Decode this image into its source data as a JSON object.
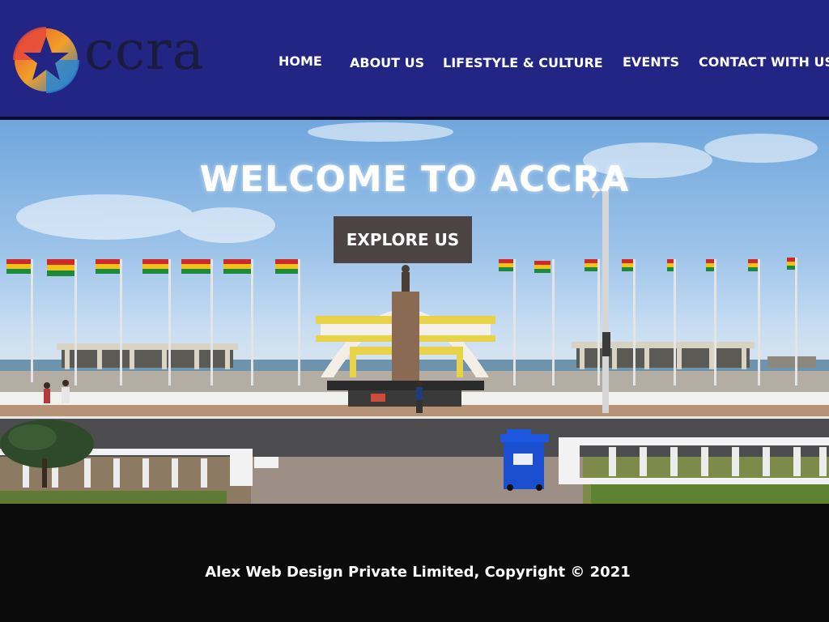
{
  "brand": {
    "logo_word": "ccra",
    "logo_tag": "",
    "logo_icon": "star-globe-icon"
  },
  "nav": {
    "items": [
      {
        "label": "HOME"
      },
      {
        "label": "ABOUT US"
      },
      {
        "label": "LIFESTYLE & CULTURE"
      },
      {
        "label": "EVENTS"
      },
      {
        "label": "CONTACT WITH US"
      }
    ]
  },
  "hero": {
    "title": "WELCOME TO ACCRA",
    "button_label": "EXPLORE US",
    "image": "independence-square-photo"
  },
  "footer": {
    "copyright": "Alex Web Design Private Limited, Copyright © 2021"
  },
  "colors": {
    "header_bg": "#232584",
    "button_bg": "#4b4344",
    "footer_bg": "#0b0b0b",
    "text": "#ffffff"
  }
}
